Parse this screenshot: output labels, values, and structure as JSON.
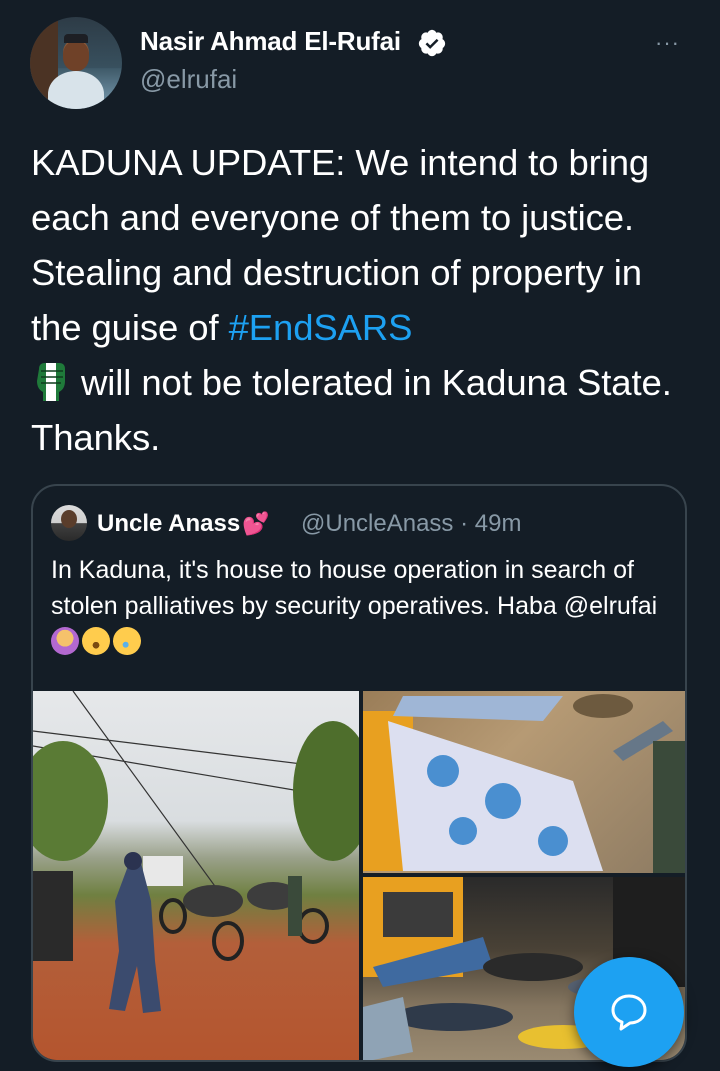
{
  "tweet": {
    "author_name": "Nasir Ahmad El-Rufai",
    "author_handle": "@elrufai",
    "more_icon": "···",
    "text_before_hashtag": "KADUNA UPDATE: We intend to bring each and everyone of them to justice. Stealing and destruction of property in the guise of ",
    "hashtag": "#EndSARS",
    "text_after_emoji": "will not be tolerated in Kaduna State. Thanks."
  },
  "quoted_tweet": {
    "author_name": "Uncle Anass",
    "author_emoji": "💕",
    "handle_time": "@UncleAnass · 49m",
    "text": "In Kaduna, it's house to house operation in search of stolen palliatives by security operatives. Haba @elrufai",
    "emojis": [
      "woman-gesturing-no-emoji",
      "astonished-face-emoji",
      "rolling-laughing-emoji"
    ]
  },
  "icons": {
    "verified": "verified-badge-icon",
    "compose_fab": "speech-bubble-icon"
  },
  "colors": {
    "background": "#141d26",
    "accent": "#1da1f2",
    "secondary_text": "#8899a6",
    "border": "#38444d"
  }
}
